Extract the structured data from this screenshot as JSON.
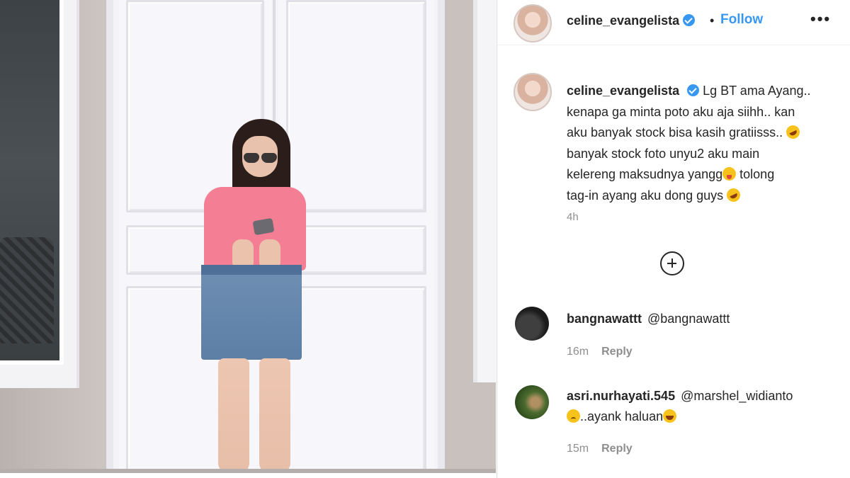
{
  "post": {
    "username": "celine_evangelista",
    "follow_label": "Follow",
    "separator": "•",
    "more_label": "•••",
    "caption": {
      "username": "celine_evangelista",
      "lines": [
        "Lg BT ama Ayang..",
        "kenapa ga minta poto aku aja siihh.. kan",
        "aku banyak stock bisa kasih gratiisss..",
        "banyak stock foto unyu2 aku main",
        "kelereng maksudnya yangg",
        "tolong",
        "tag-in ayang aku dong guys"
      ],
      "time": "4h"
    },
    "load_more_icon": "plus-circle-icon",
    "comments": [
      {
        "username": "bangnawattt",
        "text_lines": [
          "@bangnawattt"
        ],
        "time": "16m",
        "reply_label": "Reply"
      },
      {
        "username": "asri.nurhayati.545",
        "text_lines": [
          "@marshel_widianto",
          "..ayank haluan"
        ],
        "time": "15m",
        "reply_label": "Reply"
      }
    ]
  },
  "colors": {
    "link_blue": "#3897f0",
    "muted_gray": "#8e8e8e",
    "text_dark": "#262626"
  }
}
